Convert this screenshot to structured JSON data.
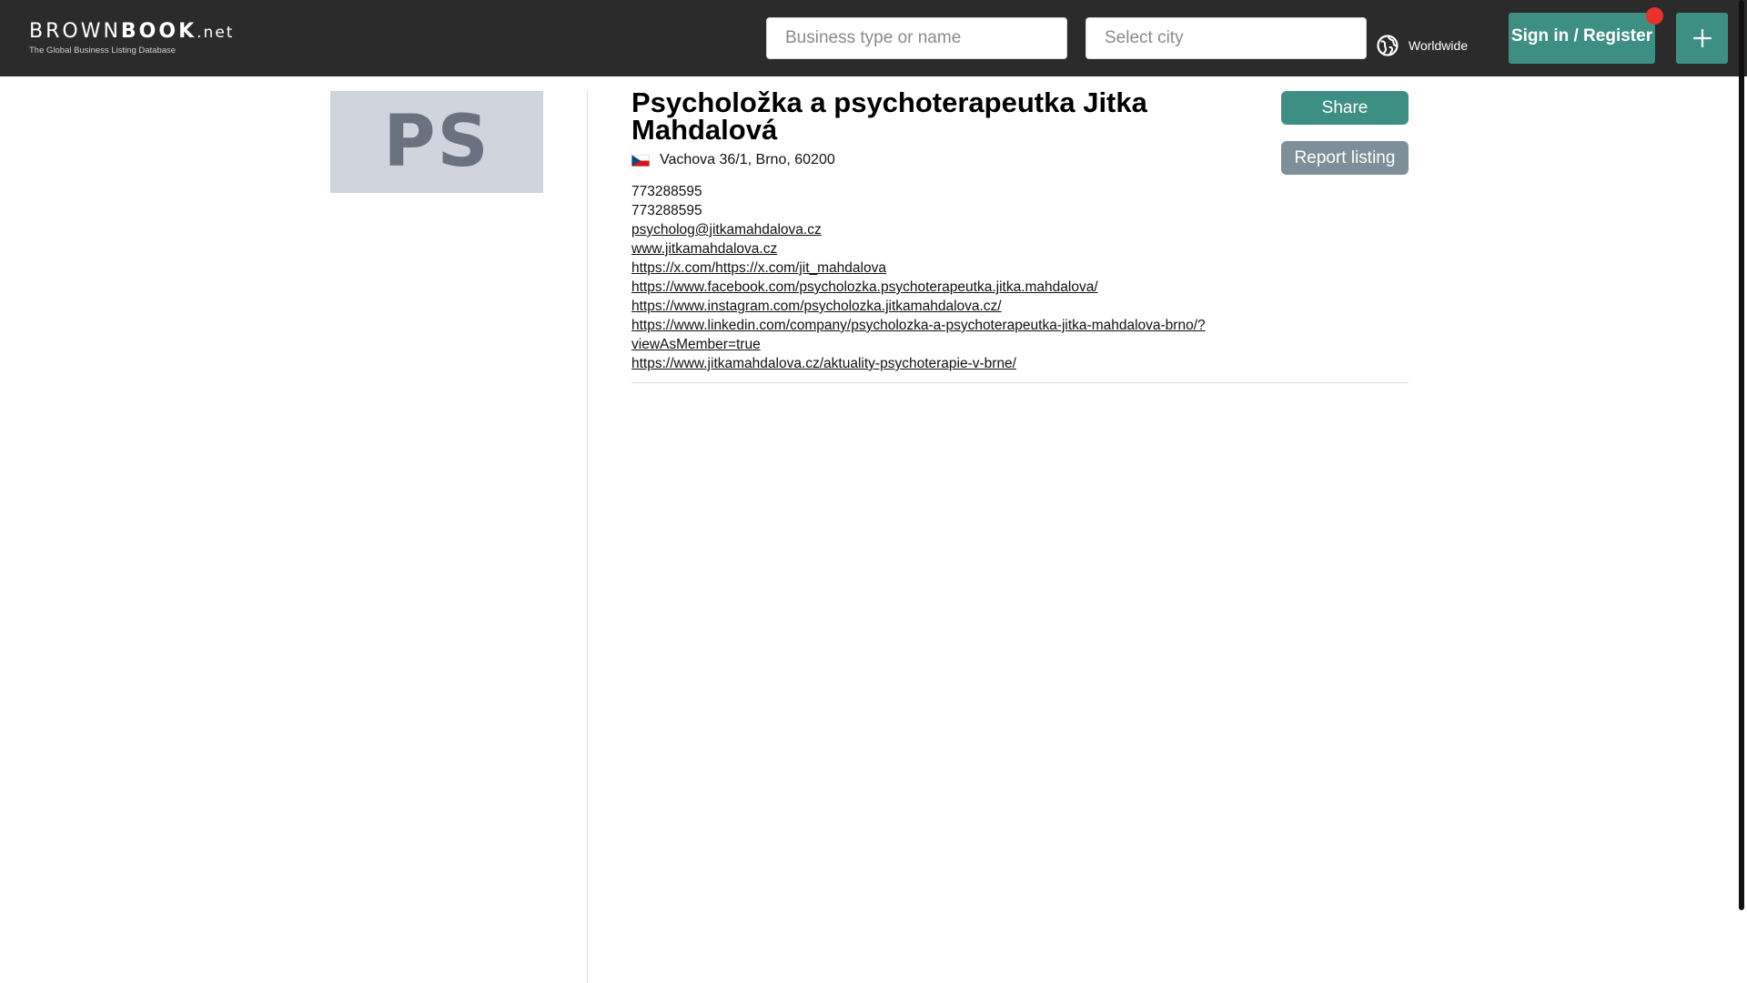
{
  "header": {
    "logo": {
      "brown": "BROWN",
      "book": "BOOK",
      "net": ".net",
      "tagline": "The Global Business Listing Database"
    },
    "search": {
      "business_placeholder": "Business type or name",
      "city_placeholder": "Select city"
    },
    "location_label": "Worldwide",
    "signin_label": "Sign in / Register",
    "add_icon": "plus-icon",
    "notification_color": "#e8322b"
  },
  "sidebar": {
    "avatar_initials": "PS"
  },
  "listing": {
    "title": "Psycholožka a psychoterapeutka Jitka Mahdalová",
    "country_flag": "czech-flag-icon",
    "address": "Vachova 36/1, Brno, 60200",
    "phone_1": "773288595",
    "phone_2": "773288595",
    "email": "psycholog@jitkamahdalova.cz",
    "website": "www.jitkamahdalova.cz",
    "twitter": "https://x.com/https://x.com/jit_mahdalova",
    "facebook": "https://www.facebook.com/psycholozka.psychoterapeutka.jitka.mahdalova/",
    "instagram": "https://www.instagram.com/psycholozka.jitkamahdalova.cz/",
    "linkedin": "https://www.linkedin.com/company/psycholozka-a-psychoterapeutka-jitka-mahdalova-brno/?viewAsMember=true",
    "blog": "https://www.jitkamahdalova.cz/aktuality-psychoterapie-v-brne/"
  },
  "actions": {
    "share_label": "Share",
    "report_label": "Report listing"
  },
  "colors": {
    "header_bg": "#2b2b2b",
    "accent": "#3e8f83",
    "report_bg": "#7d8f99"
  }
}
